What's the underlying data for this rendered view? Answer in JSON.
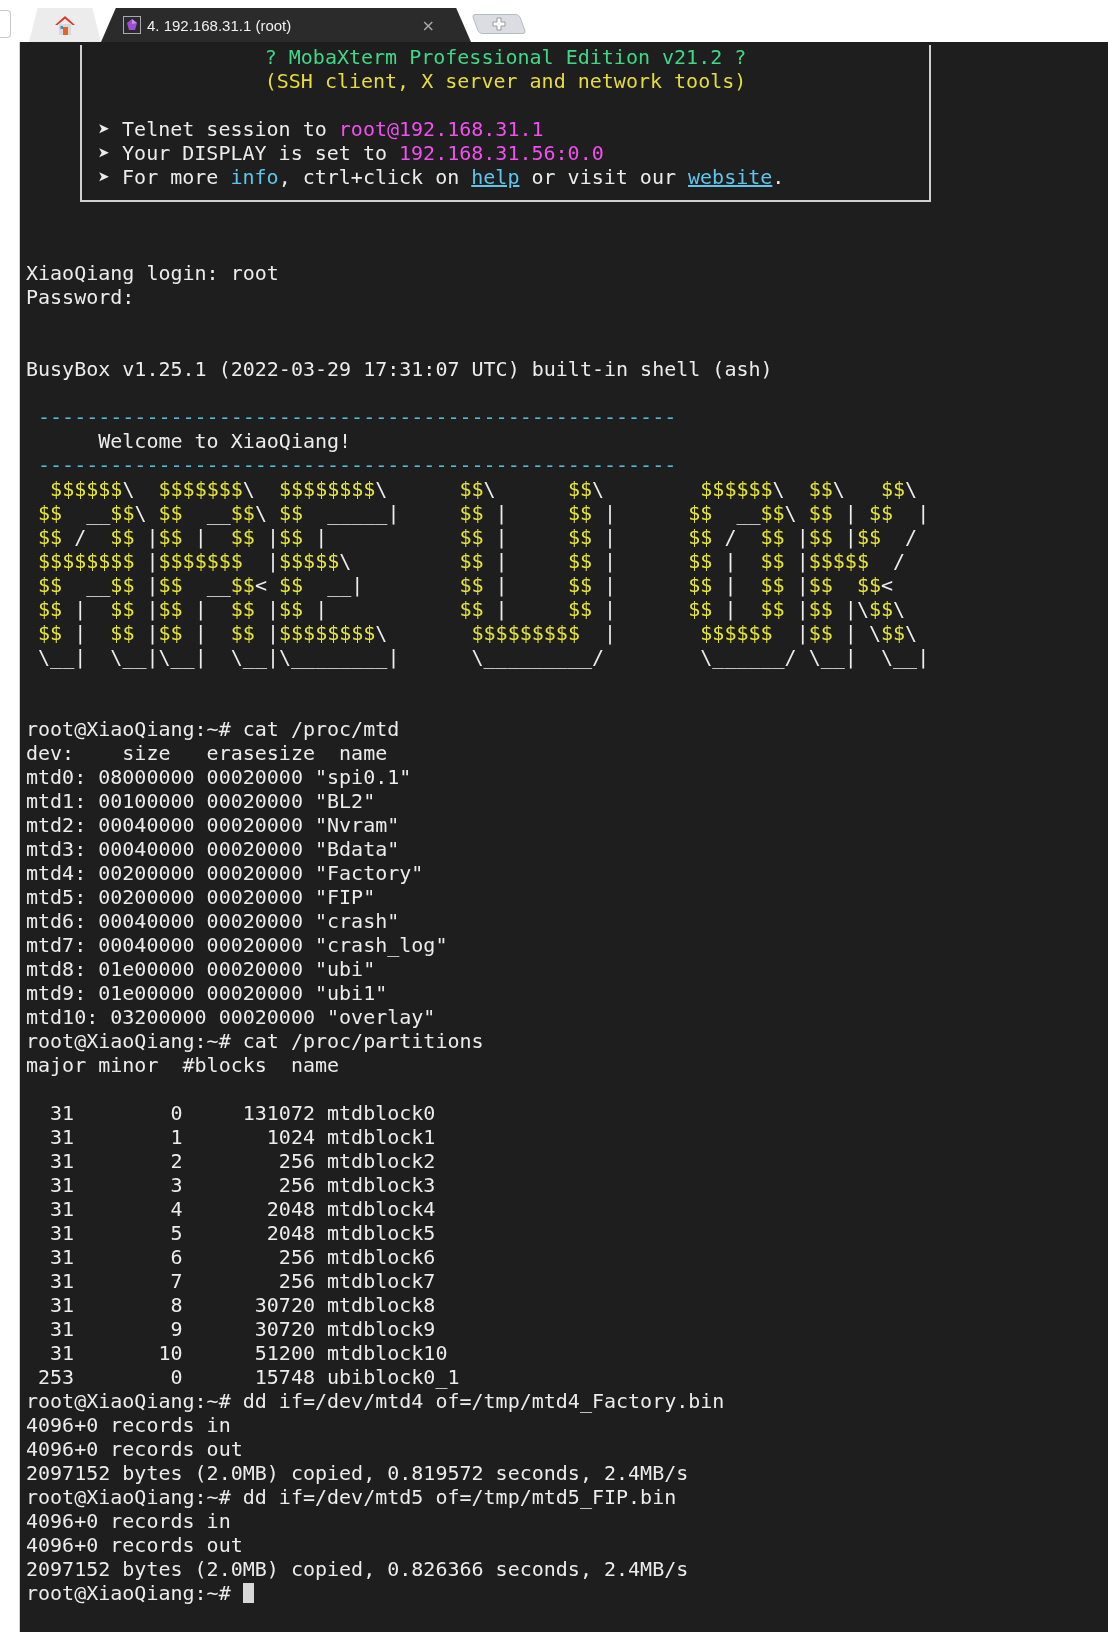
{
  "tabs": [
    {
      "kind": "home",
      "selected": false
    },
    {
      "kind": "session",
      "label": "4. 192.168.31.1 (root)",
      "close": "×",
      "selected": true
    },
    {
      "kind": "new"
    }
  ],
  "banner": {
    "title": "? MobaXterm Professional Edition v21.2 ?",
    "subtitle": "(SSH client, X server and network tools)",
    "lines": [
      {
        "segments": [
          {
            "kind": "plain",
            "text": "➤ Telnet session to "
          },
          {
            "kind": "host",
            "text": "root@192.168.31.1"
          }
        ]
      },
      {
        "segments": [
          {
            "kind": "plain",
            "text": "➤ Your DISPLAY is set to "
          },
          {
            "kind": "host",
            "text": "192.168.31.56:0.0"
          }
        ]
      },
      {
        "segments": [
          {
            "kind": "plain",
            "text": "➤ For more "
          },
          {
            "kind": "link",
            "text": "info"
          },
          {
            "kind": "plain",
            "text": ", ctrl+click on "
          },
          {
            "kind": "ulink",
            "text": "help"
          },
          {
            "kind": "plain",
            "text": " or visit our "
          },
          {
            "kind": "ulink",
            "text": "website"
          },
          {
            "kind": "plain",
            "text": "."
          }
        ]
      }
    ]
  },
  "terminal": [
    {
      "kind": "blank"
    },
    {
      "kind": "blank"
    },
    {
      "kind": "text",
      "text": "XiaoQiang login: root"
    },
    {
      "kind": "text",
      "text": "Password:"
    },
    {
      "kind": "blank"
    },
    {
      "kind": "blank"
    },
    {
      "kind": "text",
      "text": "BusyBox v1.25.1 (2022-03-29 17:31:07 UTC) built-in shell (ash)"
    },
    {
      "kind": "blank"
    },
    {
      "kind": "rule",
      "text": " -----------------------------------------------------"
    },
    {
      "kind": "text",
      "text": "      Welcome to XiaoQiang!"
    },
    {
      "kind": "rule",
      "text": " -----------------------------------------------------"
    },
    {
      "kind": "art",
      "parts": [
        "  $$$$$$\\  $$$$$$$\\  $$$$$$$$\\",
        "$$\\      $$\\",
        " $$$$$$\\  $$\\   $$\\"
      ]
    },
    {
      "kind": "art",
      "parts": [
        " $$  __$$\\ $$  __$$\\ $$  _____|",
        "$$ |     $$ |",
        "$$  __$$\\ $$ | $$  |"
      ]
    },
    {
      "kind": "art",
      "parts": [
        " $$ /  $$ |$$ |  $$ |$$ |",
        "$$ |     $$ |",
        "$$ /  $$ |$$ |$$  /"
      ]
    },
    {
      "kind": "art",
      "parts": [
        " $$$$$$$$ |$$$$$$$  |$$$$$\\",
        "$$ |     $$ |",
        "$$ |  $$ |$$$$$  /"
      ]
    },
    {
      "kind": "art",
      "parts": [
        " $$  __$$ |$$  __$$< $$  __|",
        "$$ |     $$ |",
        "$$ |  $$ |$$  $$<"
      ]
    },
    {
      "kind": "art",
      "parts": [
        " $$ |  $$ |$$ |  $$ |$$ |",
        "$$ |     $$ |",
        "$$ |  $$ |$$ |\\$$\\"
      ]
    },
    {
      "kind": "art",
      "parts": [
        " $$ |  $$ |$$ |  $$ |$$$$$$$$\\",
        " $$$$$$$$$  |",
        " $$$$$$  |$$ | \\$$\\"
      ]
    },
    {
      "kind": "art",
      "parts": [
        " \\__|  \\__|\\__|  \\__|\\________|",
        " \\_________/",
        " \\______/ \\__|  \\__|"
      ]
    },
    {
      "kind": "blank"
    },
    {
      "kind": "blank"
    },
    {
      "kind": "text",
      "text": "root@XiaoQiang:~# cat /proc/mtd"
    },
    {
      "kind": "text",
      "text": "dev:    size   erasesize  name"
    },
    {
      "kind": "text",
      "text": "mtd0: 08000000 00020000 \"spi0.1\""
    },
    {
      "kind": "text",
      "text": "mtd1: 00100000 00020000 \"BL2\""
    },
    {
      "kind": "text",
      "text": "mtd2: 00040000 00020000 \"Nvram\""
    },
    {
      "kind": "text",
      "text": "mtd3: 00040000 00020000 \"Bdata\""
    },
    {
      "kind": "text",
      "text": "mtd4: 00200000 00020000 \"Factory\""
    },
    {
      "kind": "text",
      "text": "mtd5: 00200000 00020000 \"FIP\""
    },
    {
      "kind": "text",
      "text": "mtd6: 00040000 00020000 \"crash\""
    },
    {
      "kind": "text",
      "text": "mtd7: 00040000 00020000 \"crash_log\""
    },
    {
      "kind": "text",
      "text": "mtd8: 01e00000 00020000 \"ubi\""
    },
    {
      "kind": "text",
      "text": "mtd9: 01e00000 00020000 \"ubi1\""
    },
    {
      "kind": "text",
      "text": "mtd10: 03200000 00020000 \"overlay\""
    },
    {
      "kind": "text",
      "text": "root@XiaoQiang:~# cat /proc/partitions"
    },
    {
      "kind": "text",
      "text": "major minor  #blocks  name"
    },
    {
      "kind": "blank"
    },
    {
      "kind": "text",
      "text": "  31        0     131072 mtdblock0"
    },
    {
      "kind": "text",
      "text": "  31        1       1024 mtdblock1"
    },
    {
      "kind": "text",
      "text": "  31        2        256 mtdblock2"
    },
    {
      "kind": "text",
      "text": "  31        3        256 mtdblock3"
    },
    {
      "kind": "text",
      "text": "  31        4       2048 mtdblock4"
    },
    {
      "kind": "text",
      "text": "  31        5       2048 mtdblock5"
    },
    {
      "kind": "text",
      "text": "  31        6        256 mtdblock6"
    },
    {
      "kind": "text",
      "text": "  31        7        256 mtdblock7"
    },
    {
      "kind": "text",
      "text": "  31        8      30720 mtdblock8"
    },
    {
      "kind": "text",
      "text": "  31        9      30720 mtdblock9"
    },
    {
      "kind": "text",
      "text": "  31       10      51200 mtdblock10"
    },
    {
      "kind": "text",
      "text": " 253        0      15748 ubiblock0_1"
    },
    {
      "kind": "text",
      "text": "root@XiaoQiang:~# dd if=/dev/mtd4 of=/tmp/mtd4_Factory.bin"
    },
    {
      "kind": "text",
      "text": "4096+0 records in"
    },
    {
      "kind": "text",
      "text": "4096+0 records out"
    },
    {
      "kind": "text",
      "text": "2097152 bytes (2.0MB) copied, 0.819572 seconds, 2.4MB/s"
    },
    {
      "kind": "text",
      "text": "root@XiaoQiang:~# dd if=/dev/mtd5 of=/tmp/mtd5_FIP.bin"
    },
    {
      "kind": "text",
      "text": "4096+0 records in"
    },
    {
      "kind": "text",
      "text": "4096+0 records out"
    },
    {
      "kind": "text",
      "text": "2097152 bytes (2.0MB) copied, 0.826366 seconds, 2.4MB/s"
    },
    {
      "kind": "prompt",
      "text": "root@XiaoQiang:~# ",
      "cursor": true
    }
  ]
}
